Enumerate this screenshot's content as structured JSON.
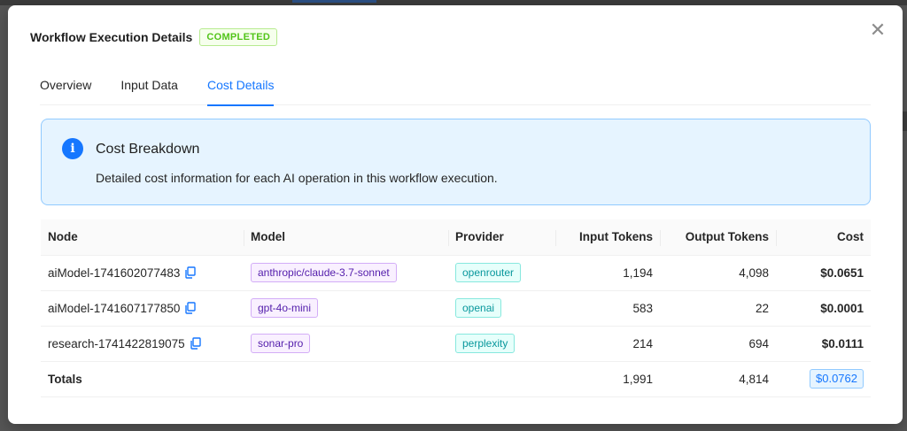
{
  "modal": {
    "title": "Workflow Execution Details",
    "status": "COMPLETED",
    "close_icon": "close-icon"
  },
  "tabs": [
    {
      "label": "Overview",
      "active": false
    },
    {
      "label": "Input Data",
      "active": false
    },
    {
      "label": "Cost Details",
      "active": true
    }
  ],
  "alert": {
    "icon": "info-icon",
    "title": "Cost Breakdown",
    "description": "Detailed cost information for each AI operation in this workflow execution."
  },
  "table": {
    "columns": [
      "Node",
      "Model",
      "Provider",
      "Input Tokens",
      "Output Tokens",
      "Cost"
    ],
    "rows": [
      {
        "node": "aiModel-1741602077483",
        "model": "anthropic/claude-3.7-sonnet",
        "provider": "openrouter",
        "input_tokens": "1,194",
        "output_tokens": "4,098",
        "cost": "$0.0651"
      },
      {
        "node": "aiModel-1741607177850",
        "model": "gpt-4o-mini",
        "provider": "openai",
        "input_tokens": "583",
        "output_tokens": "22",
        "cost": "$0.0001"
      },
      {
        "node": "research-1741422819075",
        "model": "sonar-pro",
        "provider": "perplexity",
        "input_tokens": "214",
        "output_tokens": "694",
        "cost": "$0.0111"
      }
    ],
    "totals": {
      "label": "Totals",
      "input_tokens": "1,991",
      "output_tokens": "4,814",
      "cost": "$0.0762"
    }
  },
  "colors": {
    "primary": "#1677ff",
    "success": "#52c41a",
    "model_tag": "#531dab",
    "provider_tag": "#08979c"
  }
}
